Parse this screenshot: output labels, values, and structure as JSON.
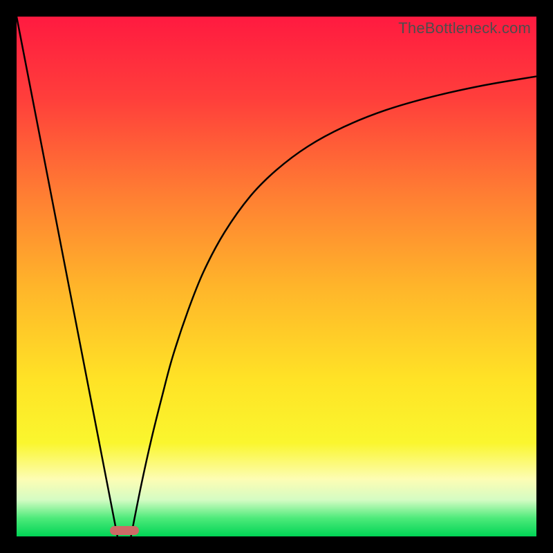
{
  "watermark": "TheBottleneck.com",
  "chart_data": {
    "type": "line",
    "title": "",
    "xlabel": "",
    "ylabel": "",
    "xlim": [
      0,
      100
    ],
    "ylim": [
      0,
      100
    ],
    "gradient_stops": [
      {
        "offset": 0.0,
        "color": "#ff1a40"
      },
      {
        "offset": 0.16,
        "color": "#ff3f3b"
      },
      {
        "offset": 0.34,
        "color": "#ff7d33"
      },
      {
        "offset": 0.52,
        "color": "#ffb52a"
      },
      {
        "offset": 0.7,
        "color": "#ffe326"
      },
      {
        "offset": 0.82,
        "color": "#faf62e"
      },
      {
        "offset": 0.89,
        "color": "#fdfdb4"
      },
      {
        "offset": 0.93,
        "color": "#d4fcc3"
      },
      {
        "offset": 0.965,
        "color": "#4dea7a"
      },
      {
        "offset": 1.0,
        "color": "#00d455"
      }
    ],
    "series": [
      {
        "name": "left-ray",
        "type": "line",
        "x": [
          0,
          19.4
        ],
        "y": [
          100,
          0
        ]
      },
      {
        "name": "right-curve",
        "type": "line",
        "x": [
          22.0,
          24,
          26,
          28,
          30,
          33,
          36,
          40,
          45,
          50,
          56,
          63,
          71,
          80,
          90,
          100
        ],
        "y": [
          0.0,
          10.0,
          19.0,
          27.0,
          34.5,
          43.5,
          51.0,
          58.5,
          65.5,
          70.5,
          75.0,
          78.8,
          82.0,
          84.6,
          86.8,
          88.5
        ]
      }
    ],
    "marker": {
      "name": "optimal-zone",
      "x_center_pct": 20.7,
      "width_pct": 5.6,
      "color": "#cc6b66"
    }
  }
}
